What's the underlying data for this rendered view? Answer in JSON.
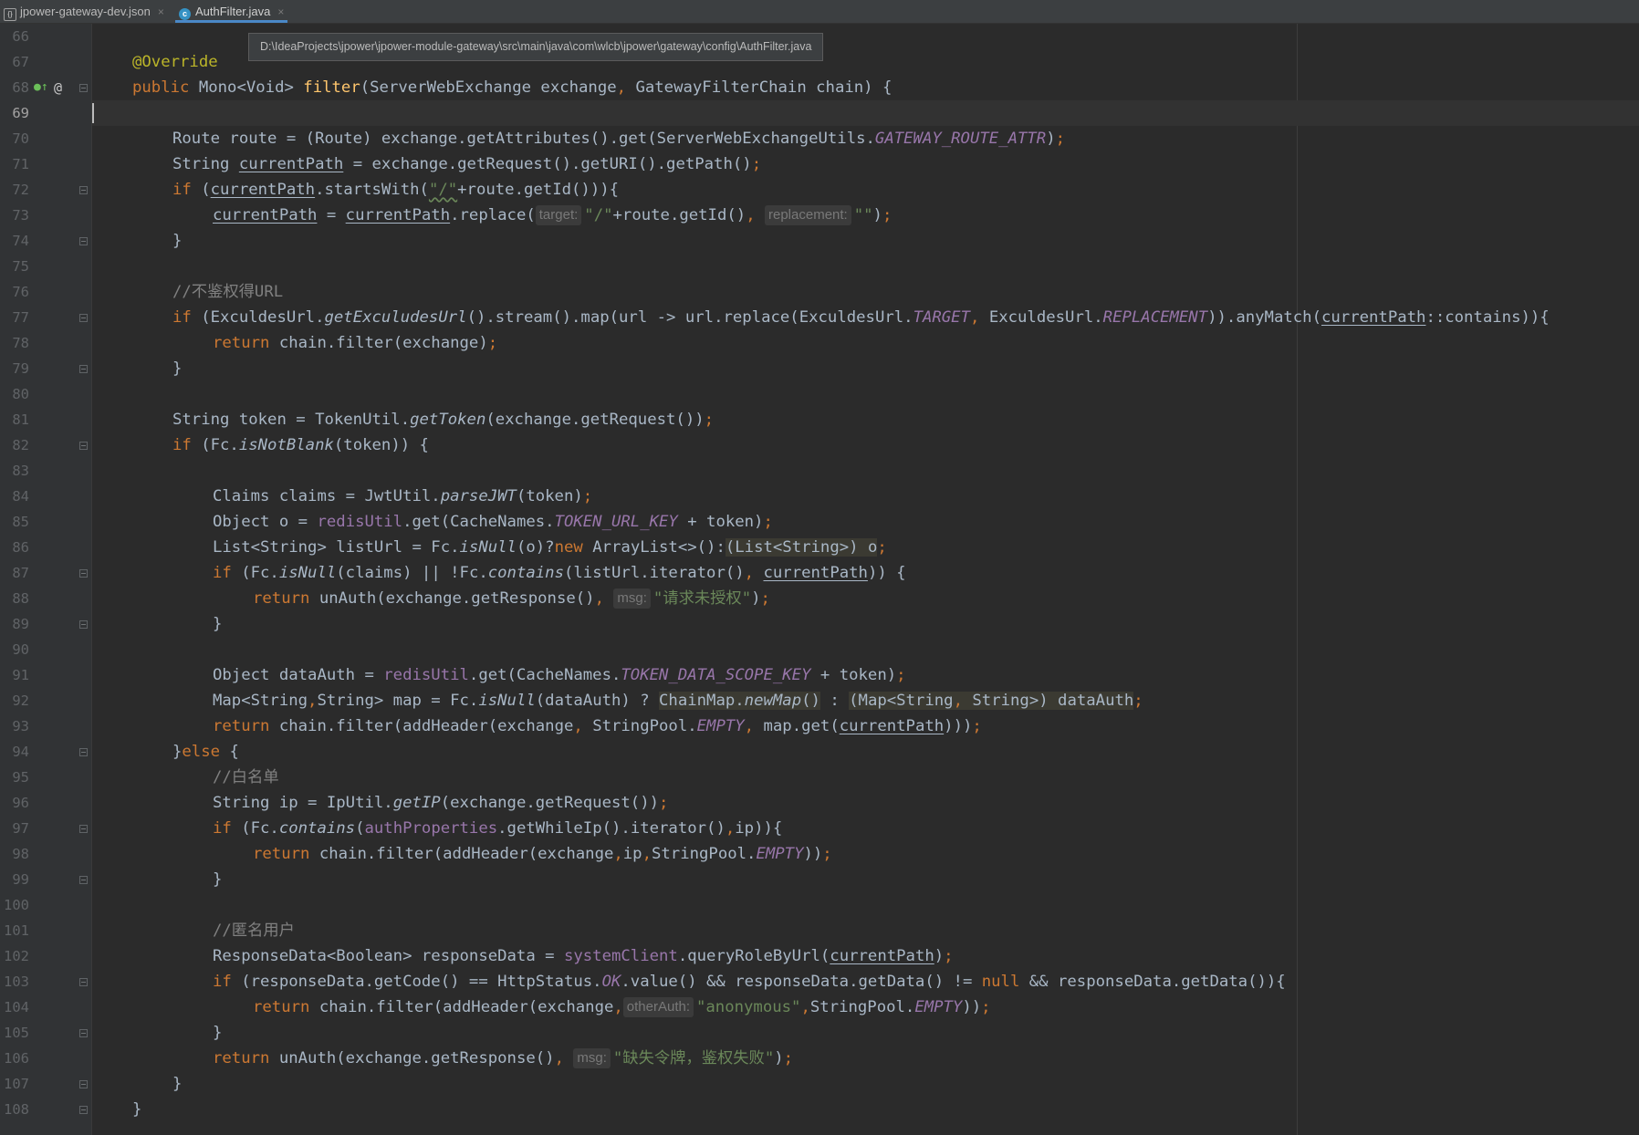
{
  "tabs": [
    {
      "label": "jpower-gateway-dev.json",
      "icon": "json-file-icon",
      "active": false
    },
    {
      "label": "AuthFilter.java",
      "icon": "java-class-icon",
      "active": true
    }
  ],
  "tooltip": "D:\\IdeaProjects\\jpower\\jpower-module-gateway\\src\\main\\java\\com\\wlcb\\jpower\\gateway\\config\\AuthFilter.java",
  "editor": {
    "current_line": 69,
    "line_numbers": [
      "66",
      "67",
      "68",
      "69",
      "70",
      "71",
      "72",
      "73",
      "74",
      "75",
      "76",
      "77",
      "78",
      "79",
      "80",
      "81",
      "82",
      "83",
      "84",
      "85",
      "86",
      "87",
      "88",
      "89",
      "90",
      "91",
      "92",
      "93",
      "94",
      "95",
      "96",
      "97",
      "98",
      "99",
      "100",
      "101",
      "102",
      "103",
      "104",
      "105",
      "106",
      "107",
      "108"
    ],
    "fold_lines": [
      68,
      72,
      74,
      77,
      79,
      82,
      87,
      89,
      94,
      97,
      99,
      103,
      105,
      107,
      108
    ],
    "code": {
      "l67": "@Override",
      "l68": [
        "public ",
        "Mono<Void> ",
        "filter",
        "(ServerWebExchange exchange",
        ", ",
        "GatewayFilterChain chain) {"
      ],
      "l70": [
        "Route route = (Route) exchange.getAttributes().get(ServerWebExchangeUtils.",
        "GATEWAY_ROUTE_ATTR",
        ")",
        ";"
      ],
      "l71": [
        "String ",
        "currentPath",
        " = exchange.getRequest().getURI().getPath()",
        ";"
      ],
      "l72": [
        "if ",
        "(",
        "currentPath",
        ".startsWith(",
        "\"/\"",
        "+route.getId())){"
      ],
      "l73": [
        "currentPath",
        " = ",
        "currentPath",
        ".replace(",
        "target:",
        "\"/\"",
        "+route.getId()",
        ", ",
        "replacement:",
        "\"\"",
        ")",
        ";"
      ],
      "l74": "}",
      "l76": "//不鉴权得URL",
      "l77": [
        "if ",
        "(ExculdesUrl.",
        "getExculudesUrl",
        "().stream().map(url -> url.replace(ExculdesUrl.",
        "TARGET",
        ", ",
        "ExculdesUrl.",
        "REPLACEMENT",
        ")).anyMatch(",
        "currentPath",
        "::contains)){"
      ],
      "l78": [
        "return ",
        "chain.filter(exchange)",
        ";"
      ],
      "l79": "}",
      "l81": [
        "String token = TokenUtil.",
        "getToken",
        "(exchange.getRequest())",
        ";"
      ],
      "l82": [
        "if ",
        "(Fc.",
        "isNotBlank",
        "(token)) {"
      ],
      "l84": [
        "Claims claims = JwtUtil.",
        "parseJWT",
        "(token)",
        ";"
      ],
      "l85": [
        "Object o = ",
        "redisUtil",
        ".get(CacheNames.",
        "TOKEN_URL_KEY",
        " + token)",
        ";"
      ],
      "l86": [
        "List<String> listUrl = Fc.",
        "isNull",
        "(o)?",
        "new ",
        "ArrayList<>():",
        "(List<String>) o",
        ";"
      ],
      "l87": [
        "if ",
        "(Fc.",
        "isNull",
        "(claims) || !Fc.",
        "contains",
        "(listUrl.iterator()",
        ", ",
        "currentPath",
        ")) {"
      ],
      "l88": [
        "return ",
        "unAuth(exchange.getResponse()",
        ", ",
        "msg:",
        "\"请求未授权\"",
        ")",
        ";"
      ],
      "l89": "}",
      "l91": [
        "Object dataAuth = ",
        "redisUtil",
        ".get(CacheNames.",
        "TOKEN_DATA_SCOPE_KEY",
        " + token)",
        ";"
      ],
      "l92": [
        "Map<String",
        ",",
        "String> map = Fc.",
        "isNull",
        "(dataAuth) ? ",
        "ChainMap.",
        "newMap",
        "()",
        " : ",
        "(Map<String",
        ", ",
        "String>) dataAuth",
        ";"
      ],
      "l93": [
        "return ",
        "chain.filter(addHeader(exchange",
        ", ",
        "StringPool.",
        "EMPTY",
        ", ",
        "map.get(",
        "currentPath",
        ")))",
        ";"
      ],
      "l94": [
        "}",
        "else ",
        "{"
      ],
      "l95": "//白名单",
      "l96": [
        "String ip = IpUtil.",
        "getIP",
        "(exchange.getRequest())",
        ";"
      ],
      "l97": [
        "if ",
        "(Fc.",
        "contains",
        "(",
        "authProperties",
        ".getWhileIp().iterator()",
        ",",
        "ip)){"
      ],
      "l98": [
        "return ",
        "chain.filter(addHeader(exchange",
        ",",
        "ip",
        ",",
        "StringPool.",
        "EMPTY",
        "))",
        ";"
      ],
      "l99": "}",
      "l101": "//匿名用户",
      "l102": [
        "ResponseData<Boolean> responseData = ",
        "systemClient",
        ".queryRoleByUrl(",
        "currentPath",
        ")",
        ";"
      ],
      "l103": [
        "if ",
        "(responseData.getCode() == HttpStatus.",
        "OK",
        ".value() && responseData.getData() != ",
        "null ",
        "&& responseData.getData()){"
      ],
      "l104": [
        "return ",
        "chain.filter(addHeader(exchange",
        ",",
        "otherAuth:",
        "\"anonymous\"",
        ",",
        "StringPool.",
        "EMPTY",
        "))",
        ";"
      ],
      "l105": "}",
      "l106": [
        "return ",
        "unAuth(exchange.getResponse()",
        ", ",
        "msg:",
        "\"缺失令牌，鉴权失败\"",
        ")",
        ";"
      ],
      "l107": "}",
      "l108": "}"
    }
  },
  "colors": {
    "background": "#2b2b2b",
    "keyword": "#cc7832",
    "string": "#6a8759",
    "method": "#ffc66d",
    "constant": "#9876aa",
    "comment": "#808080",
    "annotation": "#bbb529"
  }
}
